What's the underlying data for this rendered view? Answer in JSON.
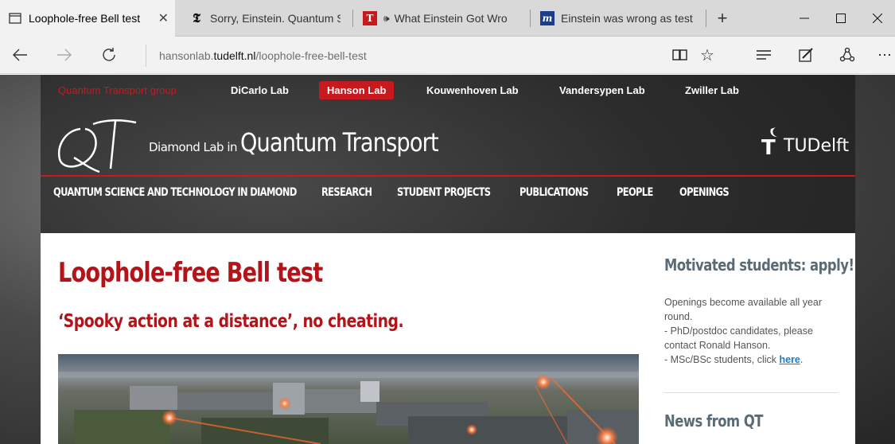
{
  "browser": {
    "tabs": [
      {
        "title": "Loophole-free Bell test",
        "favicon": "tab-page-icon",
        "active": true
      },
      {
        "title": "Sorry, Einstein. Quantum S",
        "favicon": "nyt-icon",
        "active": false
      },
      {
        "title": "What Einstein Got Wro",
        "favicon": "telegraph-icon",
        "active": false
      },
      {
        "title": "Einstein was wrong as test",
        "favicon": "m-icon",
        "active": false
      }
    ],
    "new_tab": "+",
    "url_prefix": "hansonlab.",
    "url_domain": "tudelft.nl",
    "url_path": "/loophole-free-bell-test"
  },
  "site": {
    "top_links": [
      {
        "label": "Quantum Transport group",
        "style": "group"
      },
      {
        "label": "DiCarlo Lab",
        "style": "normal"
      },
      {
        "label": "Hanson Lab",
        "style": "active"
      },
      {
        "label": "Kouwenhoven Lab",
        "style": "normal"
      },
      {
        "label": "Vandersypen Lab",
        "style": "normal"
      },
      {
        "label": "Zwiller Lab",
        "style": "normal"
      }
    ],
    "logo_text": "QT",
    "title_small": "Diamond Lab in",
    "title_big": "Quantum Transport",
    "university_logo": "TUDelft",
    "nav": [
      "QUANTUM SCIENCE AND TECHNOLOGY IN DIAMOND",
      "RESEARCH",
      "STUDENT PROJECTS",
      "PUBLICATIONS",
      "PEOPLE",
      "OPENINGS"
    ]
  },
  "article": {
    "title": "Loophole-free Bell test",
    "subtitle": "‘Spooky action at a distance’, no cheating."
  },
  "sidebar": {
    "heading": "Motivated students: apply!",
    "line1": "Openings become available all year round.",
    "line2": "- PhD/postdoc candidates, please contact Ronald Hanson.",
    "line3_prefix": "- MSc/BSc students, click ",
    "line3_link": "here",
    "line3_suffix": ".",
    "news_heading": "News from QT"
  },
  "colors": {
    "accent_red": "#c8191e",
    "title_red": "#b3141a",
    "link_blue": "#1a7bc4"
  }
}
